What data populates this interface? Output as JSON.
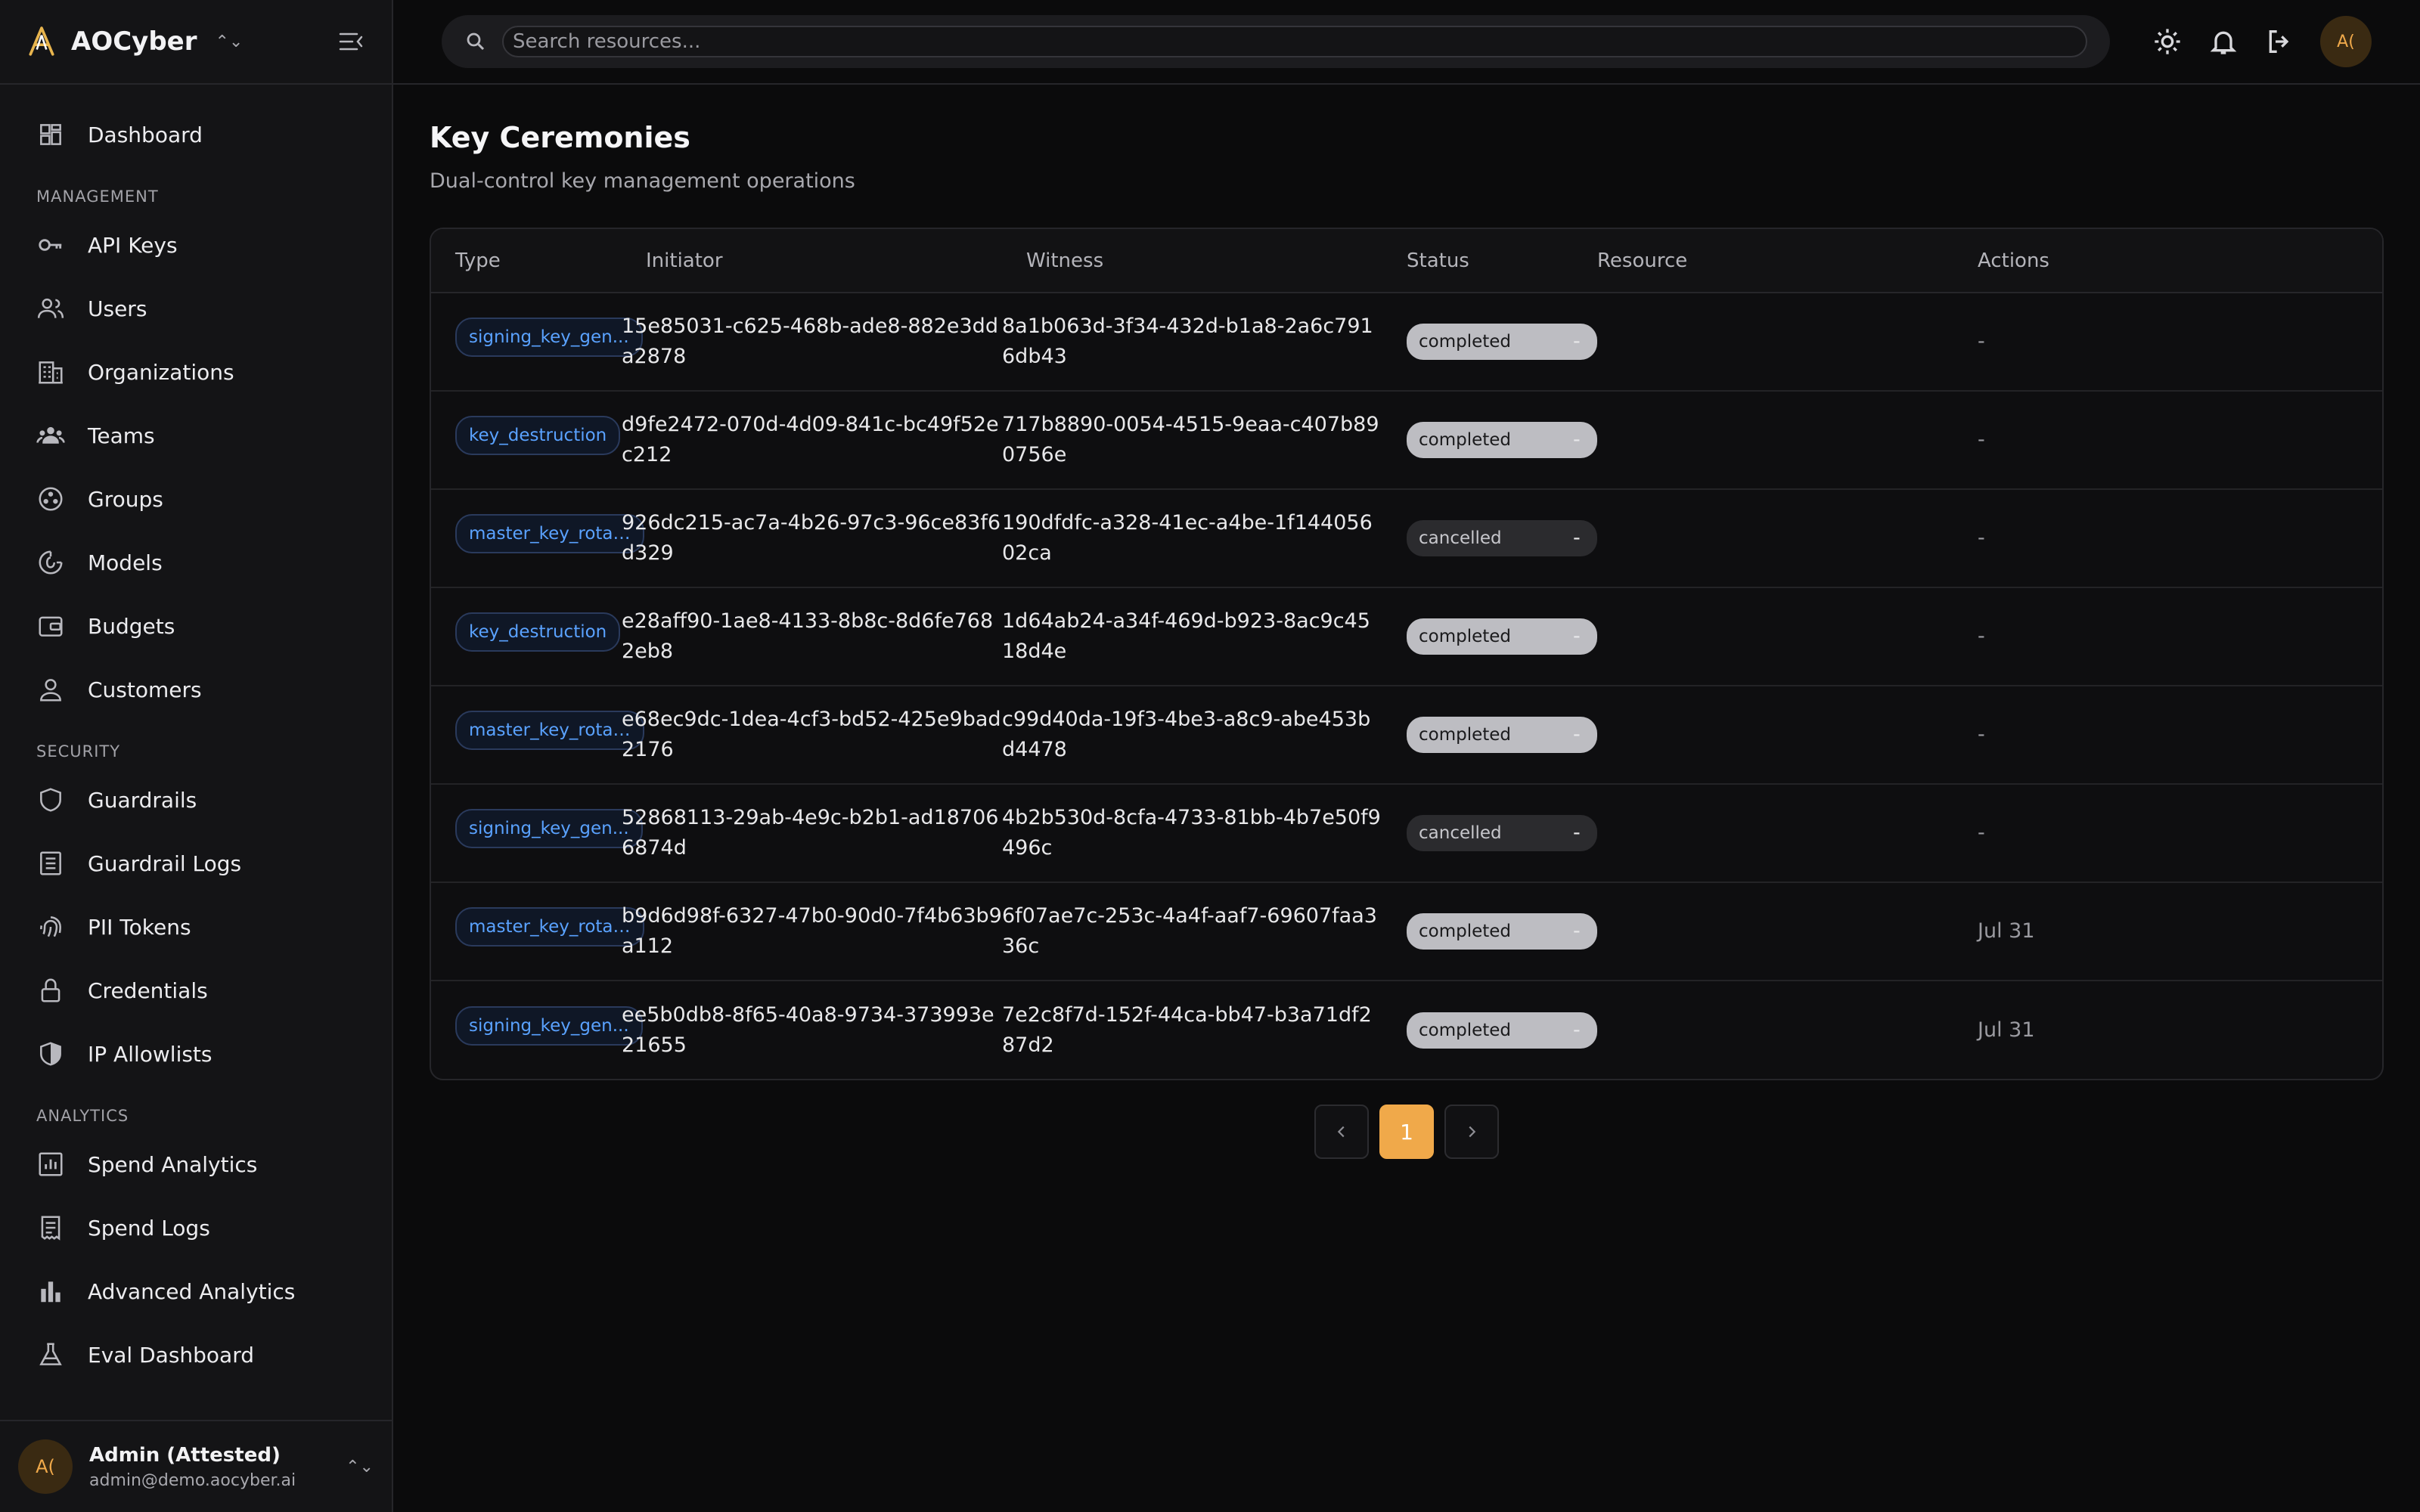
{
  "brand": {
    "name": "AOCyber"
  },
  "sidebar": {
    "top_item": {
      "label": "Dashboard",
      "icon": "dashboard-icon"
    },
    "sections": [
      {
        "label": "MANAGEMENT",
        "items": [
          {
            "label": "API Keys",
            "icon": "key-icon"
          },
          {
            "label": "Users",
            "icon": "users-icon"
          },
          {
            "label": "Organizations",
            "icon": "building-icon"
          },
          {
            "label": "Teams",
            "icon": "team-icon"
          },
          {
            "label": "Groups",
            "icon": "groups-icon"
          },
          {
            "label": "Models",
            "icon": "model-icon"
          },
          {
            "label": "Budgets",
            "icon": "wallet-icon"
          },
          {
            "label": "Customers",
            "icon": "person-icon"
          }
        ]
      },
      {
        "label": "SECURITY",
        "items": [
          {
            "label": "Guardrails",
            "icon": "shield-icon"
          },
          {
            "label": "Guardrail Logs",
            "icon": "log-icon"
          },
          {
            "label": "PII Tokens",
            "icon": "fingerprint-icon"
          },
          {
            "label": "Credentials",
            "icon": "lock-icon"
          },
          {
            "label": "IP Allowlists",
            "icon": "shield-half-icon"
          }
        ]
      },
      {
        "label": "ANALYTICS",
        "items": [
          {
            "label": "Spend Analytics",
            "icon": "chart-icon"
          },
          {
            "label": "Spend Logs",
            "icon": "receipt-icon"
          },
          {
            "label": "Advanced Analytics",
            "icon": "bar-chart-icon"
          },
          {
            "label": "Eval Dashboard",
            "icon": "flask-icon"
          }
        ]
      }
    ]
  },
  "user": {
    "initials": "A(",
    "name": "Admin (Attested)",
    "email": "admin@demo.aocyber.ai"
  },
  "search": {
    "placeholder": "Search resources..."
  },
  "topbar": {
    "avatar_initials": "A("
  },
  "page": {
    "title": "Key Ceremonies",
    "subtitle": "Dual-control key management operations"
  },
  "table": {
    "columns": [
      "Type",
      "Initiator",
      "Witness",
      "Status",
      "Resource",
      "Actions"
    ],
    "rows": [
      {
        "type": "signing_key_gen...",
        "initiator": "15e85031-c625-468b-ade8-882e3dda2878",
        "witness": "8a1b063d-3f34-432d-b1a8-2a6c7916db43",
        "status": "completed",
        "resource": "-",
        "actions": "-"
      },
      {
        "type": "key_destruction",
        "initiator": "d9fe2472-070d-4d09-841c-bc49f52ec212",
        "witness": "717b8890-0054-4515-9eaa-c407b890756e",
        "status": "completed",
        "resource": "-",
        "actions": "-"
      },
      {
        "type": "master_key_rotat...",
        "initiator": "926dc215-ac7a-4b26-97c3-96ce83f6d329",
        "witness": "190dfdfc-a328-41ec-a4be-1f14405602ca",
        "status": "cancelled",
        "resource": "-",
        "actions": "-"
      },
      {
        "type": "key_destruction",
        "initiator": "e28aff90-1ae8-4133-8b8c-8d6fe7682eb8",
        "witness": "1d64ab24-a34f-469d-b923-8ac9c4518d4e",
        "status": "completed",
        "resource": "-",
        "actions": "-"
      },
      {
        "type": "master_key_rotat...",
        "initiator": "e68ec9dc-1dea-4cf3-bd52-425e9bad2176",
        "witness": "c99d40da-19f3-4be3-a8c9-abe453bd4478",
        "status": "completed",
        "resource": "-",
        "actions": "-"
      },
      {
        "type": "signing_key_gen...",
        "initiator": "52868113-29ab-4e9c-b2b1-ad187066874d",
        "witness": "4b2b530d-8cfa-4733-81bb-4b7e50f9496c",
        "status": "cancelled",
        "resource": "-",
        "actions": "-"
      },
      {
        "type": "master_key_rotat...",
        "initiator": "b9d6d98f-6327-47b0-90d0-7f4b63b9a112",
        "witness": "6f07ae7c-253c-4a4f-aaf7-69607faa336c",
        "status": "completed",
        "resource": "-",
        "actions": "Jul 31"
      },
      {
        "type": "signing_key_gen...",
        "initiator": "ee5b0db8-8f65-40a8-9734-373993e21655",
        "witness": "7e2c8f7d-152f-44ca-bb47-b3a71df287d2",
        "status": "completed",
        "resource": "-",
        "actions": "Jul 31"
      }
    ]
  },
  "pagination": {
    "current": "1",
    "prev_icon": "chevron-left-icon",
    "next_icon": "chevron-right-icon"
  },
  "colors": {
    "accent": "#f0a94a",
    "link_blue": "#5aa2ff",
    "background": "#0b0b0c"
  }
}
